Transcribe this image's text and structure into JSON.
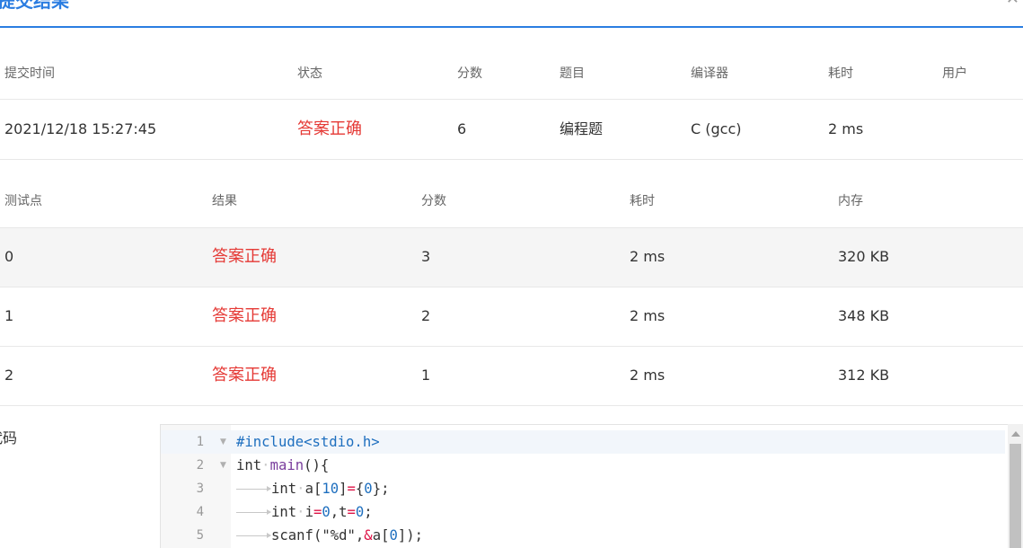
{
  "dialog": {
    "title": "提交结果",
    "close_icon": "close-icon"
  },
  "summary": {
    "headers": [
      "提交时间",
      "状态",
      "分数",
      "题目",
      "编译器",
      "耗时",
      "用户"
    ],
    "row": {
      "time": "2021/12/18 15:27:45",
      "status": "答案正确",
      "score": "6",
      "problem": "编程题",
      "compiler": "C (gcc)",
      "duration": "2 ms",
      "user": ""
    }
  },
  "cases": {
    "headers": [
      "测试点",
      "结果",
      "分数",
      "耗时",
      "内存"
    ],
    "rows": [
      {
        "id": "0",
        "result": "答案正确",
        "score": "3",
        "time": "2 ms",
        "memory": "320 KB"
      },
      {
        "id": "1",
        "result": "答案正确",
        "score": "2",
        "time": "2 ms",
        "memory": "348 KB"
      },
      {
        "id": "2",
        "result": "答案正确",
        "score": "1",
        "time": "2 ms",
        "memory": "312 KB"
      }
    ]
  },
  "code": {
    "label": "代码",
    "line_numbers": [
      "1",
      "2",
      "3",
      "4",
      "5"
    ]
  },
  "colors": {
    "accent": "#2b7de1",
    "status_ok": "#e53935"
  }
}
